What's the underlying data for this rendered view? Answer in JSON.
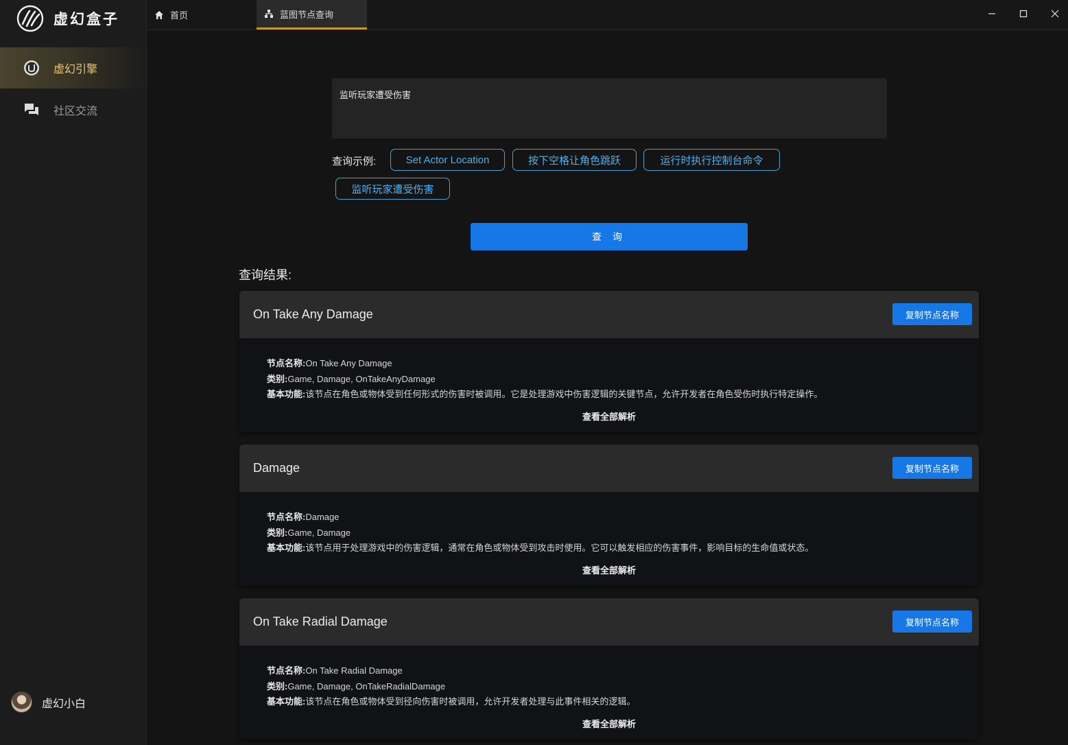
{
  "sidebar": {
    "brand_name": "虚幻盒子",
    "items": [
      {
        "label": "虚幻引擎",
        "icon": "unreal-engine-icon",
        "active": true
      },
      {
        "label": "社区交流",
        "icon": "chat-bubbles-icon",
        "active": false
      }
    ],
    "user": {
      "name": "虚幻小白"
    }
  },
  "tabs": [
    {
      "label": "首页",
      "icon": "home-icon"
    },
    {
      "label": "蓝图节点查询",
      "icon": "sitemap-icon",
      "active": true
    }
  ],
  "colors": {
    "accent_blue": "#1677e6",
    "chip_blue": "#4fb0ee",
    "active_tab_underline": "#c9953a",
    "active_nav_text": "#e8c77a"
  },
  "query": {
    "input_value": "监听玩家遭受伤害",
    "examples_label": "查询示例:",
    "examples": [
      "Set Actor Location",
      "按下空格让角色跳跃",
      "运行时执行控制台命令",
      "监听玩家遭受伤害"
    ],
    "submit_label": "查 询"
  },
  "results": {
    "title": "查询结果:",
    "name_label": "节点名称:",
    "category_label": "类别:",
    "function_label": "基本功能:",
    "copy_label": "复制节点名称",
    "view_all_label": "查看全部解析",
    "items": [
      {
        "title": "On Take Any Damage",
        "name": "On Take Any Damage",
        "category": "Game, Damage, OnTakeAnyDamage",
        "function": "该节点在角色或物体受到任何形式的伤害时被调用。它是处理游戏中伤害逻辑的关键节点，允许开发者在角色受伤时执行特定操作。"
      },
      {
        "title": "Damage",
        "name": "Damage",
        "category": "Game, Damage",
        "function": "该节点用于处理游戏中的伤害逻辑，通常在角色或物体受到攻击时使用。它可以触发相应的伤害事件，影响目标的生命值或状态。"
      },
      {
        "title": "On Take Radial Damage",
        "name": "On Take Radial Damage",
        "category": "Game, Damage, OnTakeRadialDamage",
        "function": "该节点在角色或物体受到径向伤害时被调用，允许开发者处理与此事件相关的逻辑。"
      }
    ]
  }
}
